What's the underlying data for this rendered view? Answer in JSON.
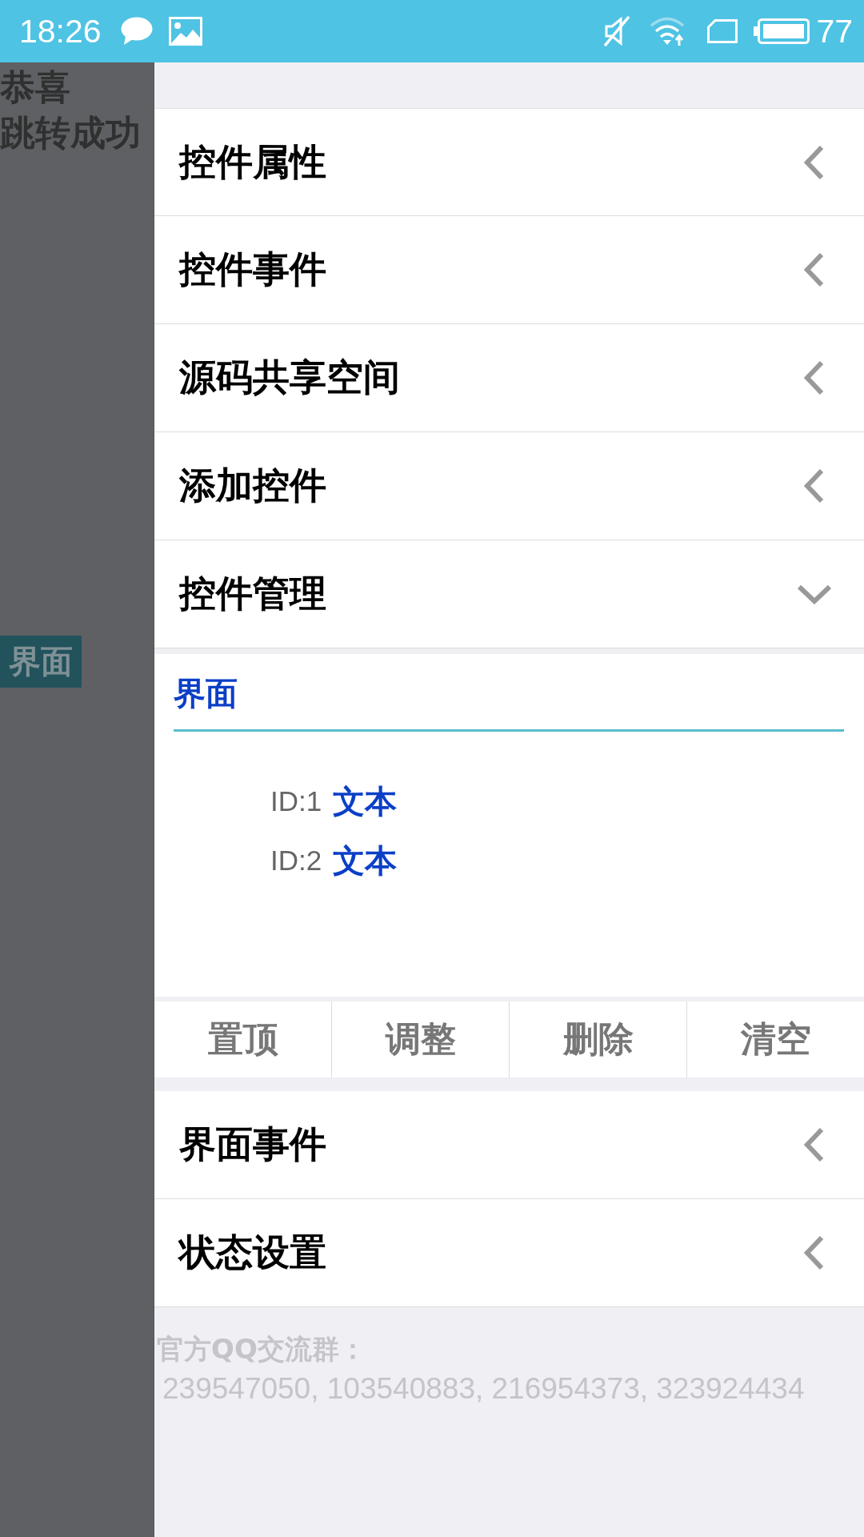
{
  "status_bar": {
    "time": "18:26",
    "battery": "77"
  },
  "background_page": {
    "lines": [
      "恭喜",
      "跳转成功"
    ],
    "button": "界面"
  },
  "drawer": {
    "sections": [
      {
        "title": "控件属性",
        "expanded": false
      },
      {
        "title": "控件事件",
        "expanded": false
      },
      {
        "title": "源码共享空间",
        "expanded": false
      },
      {
        "title": "添加控件",
        "expanded": false
      },
      {
        "title": "控件管理",
        "expanded": true,
        "content": {
          "tree": {
            "label": "界面",
            "children": [
              {
                "id": "ID:1",
                "type": "文本"
              },
              {
                "id": "ID:2",
                "type": "文本"
              }
            ]
          },
          "buttons": [
            "置顶",
            "调整",
            "删除",
            "清空"
          ]
        }
      },
      {
        "title": "界面事件",
        "expanded": false
      },
      {
        "title": "状态设置",
        "expanded": false
      }
    ],
    "footer": {
      "label": "官方QQ交流群：",
      "groups": "239547050, 103540883, 216954373, 323924434"
    }
  }
}
